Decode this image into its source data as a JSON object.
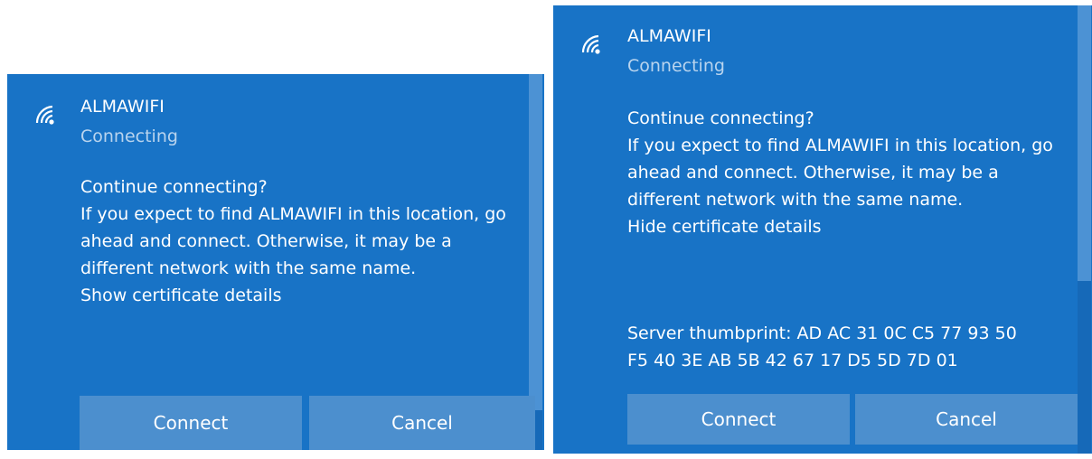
{
  "dialogs": [
    {
      "ssid": "ALMAWIFI",
      "status": "Connecting",
      "prompt": "Continue connecting?",
      "message": "If you expect to find  ALMAWIFI  in this location, go ahead and connect. Otherwise, it may be a different network with the same name.",
      "cert_toggle": "Show certificate details",
      "connect_label": "Connect",
      "cancel_label": "Cancel"
    },
    {
      "ssid": "ALMAWIFI",
      "status": "Connecting",
      "prompt": "Continue connecting?",
      "message": "If you expect to find  ALMAWIFI  in this location, go ahead and connect. Otherwise, it may be a different network with the same name.",
      "cert_toggle": "Hide certificate details",
      "thumbprint_line1": "Server thumbprint: AD AC 31 0C C5 77 93 50",
      "thumbprint_line2": "F5 40 3E AB 5B 42 67 17 D5 5D 7D 01",
      "connect_label": "Connect",
      "cancel_label": "Cancel"
    }
  ],
  "icons": {
    "network": "wifi-signal-icon"
  },
  "colors": {
    "panel_background": "#1873c6",
    "button_background": "#4c8fce",
    "status_text": "#b9d4ee",
    "text": "#ffffff"
  }
}
